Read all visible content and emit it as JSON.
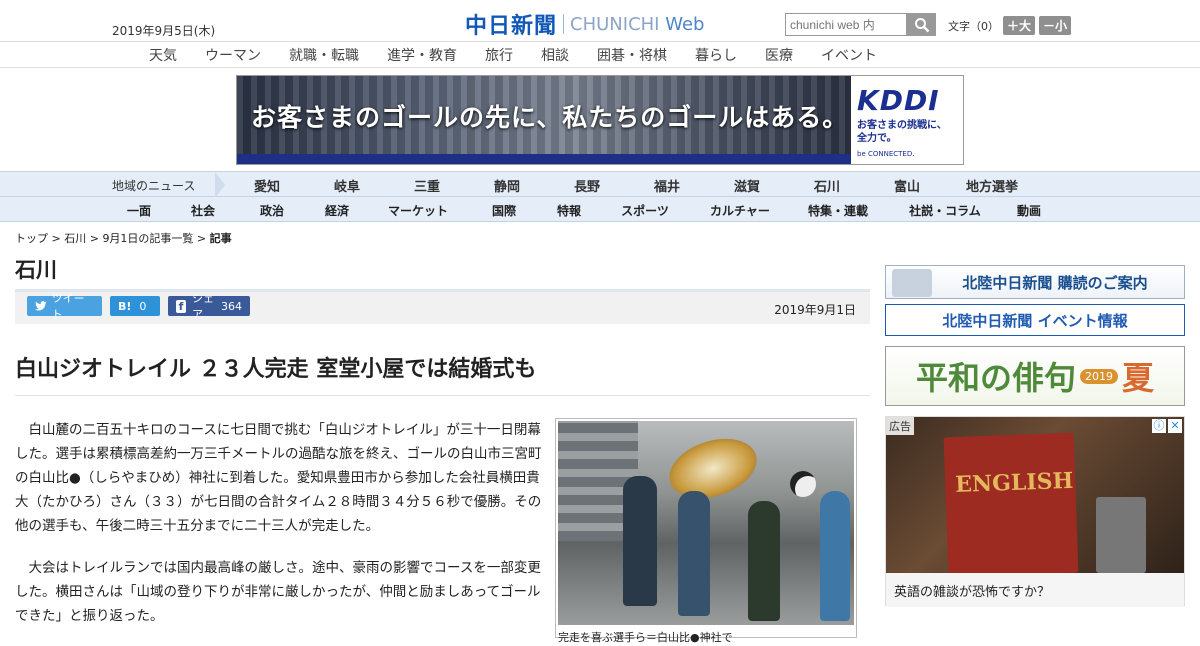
{
  "header": {
    "date": "2019年9月5日(木)",
    "logo_jp": "中日新聞",
    "logo_en_a": "CHUNICHI",
    "logo_en_b": "Web",
    "search_placeholder": "chunichi web 内",
    "font_label": "文字（0）",
    "font_plus": "＋大",
    "font_minus": "－小"
  },
  "top_nav": [
    "天気",
    "ウーマン",
    "就職・転職",
    "進学・教育",
    "旅行",
    "相談",
    "囲碁・将棋",
    "暮らし",
    "医療",
    "イベント"
  ],
  "banner": {
    "copy": "お客さまのゴールの先に、私たちのゴールはある。",
    "brand": "KDDI",
    "tagline1": "お客さまの挑戦に、",
    "tagline2": "全力で。",
    "slogan": "be CONNECTED."
  },
  "region_nav": {
    "title": "地域のニュース",
    "items": [
      "愛知",
      "岐阜",
      "三重",
      "静岡",
      "長野",
      "福井",
      "滋賀",
      "石川",
      "富山",
      "地方選挙"
    ]
  },
  "section_nav": [
    "一面",
    "社会",
    "政治",
    "経済",
    "マーケット",
    "国際",
    "特報",
    "スポーツ",
    "カルチャー",
    "特集・連載",
    "社説・コラム",
    "動画"
  ],
  "breadcrumb": {
    "top": "トップ",
    "region": "石川",
    "list": "9月1日の記事一覧",
    "current": "記事"
  },
  "page_title": "石川",
  "share": {
    "tweet": "ツイート",
    "hatena_count": "0",
    "fb_label": "シェア",
    "fb_count": "364"
  },
  "article": {
    "date": "2019年9月1日",
    "headline": "白山ジオトレイル ２３人完走 室堂小屋では結婚式も",
    "para1": "白山麓の二百五十キロのコースに七日間で挑む「白山ジオトレイル」が三十一日閉幕した。選手は累積標高差約一万三千メートルの過酷な旅を終え、ゴールの白山市三宮町の白山比●（しらやまひめ）神社に到着した。愛知県豊田市から参加した会社員横田貴大（たかひろ）さん（３３）が七日間の合計タイム２８時間３４分５６秒で優勝。その他の選手も、午後二時三十五分までに二十三人が完走した。",
    "para2": "大会はトレイルランでは国内最高峰の厳しさ。途中、豪雨の影響でコースを一部変更した。横田さんは「山域の登り下りが非常に厳しかったが、仲間と励ましあってゴールできた」と振り返った。",
    "caption": "完走を喜ぶ選手ら＝白山比●神社で"
  },
  "sidebar": {
    "subscribe": "北陸中日新聞 購読のご案内",
    "events": "北陸中日新聞 イベント情報",
    "haiku_title": "平和の俳句",
    "haiku_year": "2019",
    "haiku_season": "夏",
    "ad_label": "広告",
    "ad_book": "ENGLISH",
    "ad_text": "英語の雑談が恐怖ですか？"
  }
}
